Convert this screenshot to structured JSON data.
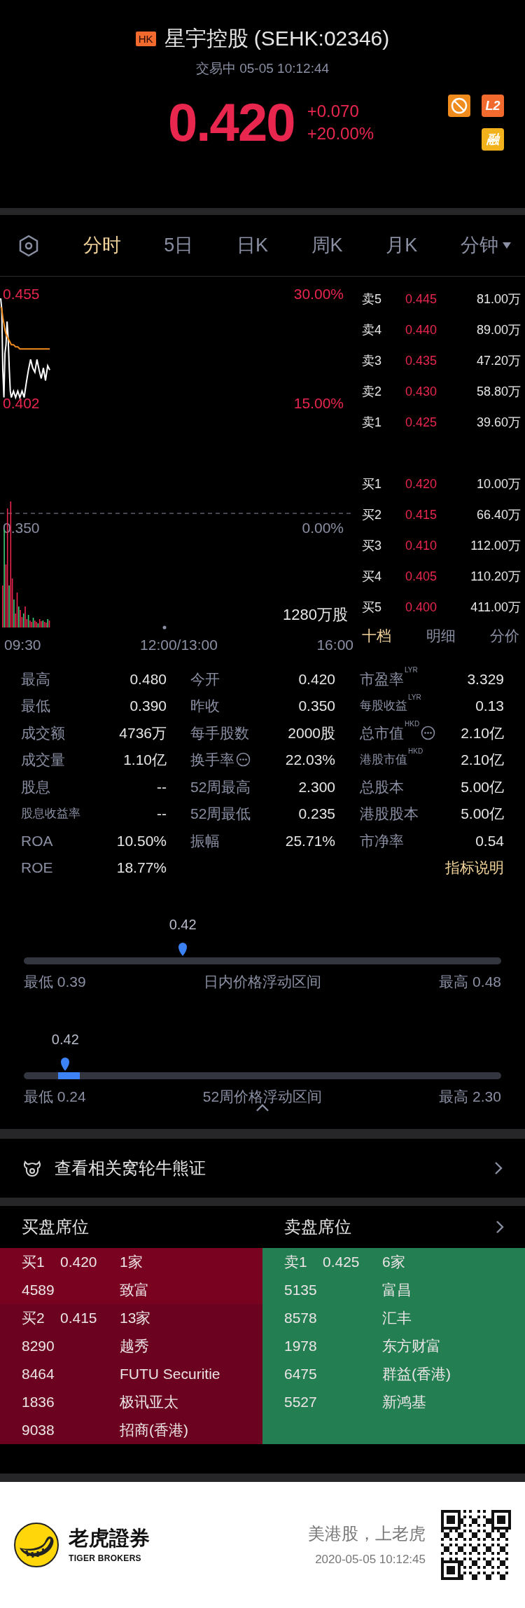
{
  "header": {
    "market_badge": "HK",
    "title": "星宇控股 (SEHK:02346)",
    "status": "交易中 05-05 10:12:44",
    "price": "0.420",
    "change": "+0.070",
    "change_pct": "+20.00%",
    "badges": [
      {
        "kind": "ban"
      },
      {
        "kind": "text",
        "text": "L2",
        "color": "#f26a2e"
      },
      {
        "kind": "text",
        "text": "融",
        "color": "#f2b21c"
      }
    ]
  },
  "chart_tabs": [
    {
      "label": "分时",
      "selected": true,
      "dropdown": false
    },
    {
      "label": "5日",
      "selected": false,
      "dropdown": false
    },
    {
      "label": "日K",
      "selected": false,
      "dropdown": false
    },
    {
      "label": "周K",
      "selected": false,
      "dropdown": false
    },
    {
      "label": "月K",
      "selected": false,
      "dropdown": false
    },
    {
      "label": "分钟",
      "selected": false,
      "dropdown": true
    }
  ],
  "intraday": {
    "price_labels": [
      "0.455",
      "0.402",
      "0.350"
    ],
    "time_labels": [
      "09:30",
      "12:00/13:00",
      "16:00"
    ],
    "pct_labels": [
      {
        "text": "30.00%",
        "color": "#e8264e"
      },
      {
        "text": "15.00%",
        "color": "#e8264e"
      },
      {
        "text": "0.00%",
        "color": "#8a8fa3"
      }
    ],
    "volume_label": "1280万股"
  },
  "order_book": {
    "asks": [
      {
        "label": "卖5",
        "price": "0.445",
        "volume": "81.00万"
      },
      {
        "label": "卖4",
        "price": "0.440",
        "volume": "89.00万"
      },
      {
        "label": "卖3",
        "price": "0.435",
        "volume": "47.20万"
      },
      {
        "label": "卖2",
        "price": "0.430",
        "volume": "58.80万"
      },
      {
        "label": "卖1",
        "price": "0.425",
        "volume": "39.60万"
      }
    ],
    "bids": [
      {
        "label": "买1",
        "price": "0.420",
        "volume": "10.00万"
      },
      {
        "label": "买2",
        "price": "0.415",
        "volume": "66.40万"
      },
      {
        "label": "买3",
        "price": "0.410",
        "volume": "112.00万"
      },
      {
        "label": "买4",
        "price": "0.405",
        "volume": "110.20万"
      },
      {
        "label": "买5",
        "price": "0.400",
        "volume": "411.00万"
      }
    ],
    "tabs": [
      {
        "label": "十档",
        "selected": true
      },
      {
        "label": "明细",
        "selected": false
      },
      {
        "label": "分价",
        "selected": false
      }
    ]
  },
  "stats": [
    [
      {
        "label": "最高",
        "value": "0.480",
        "small": false,
        "info": false
      },
      {
        "label": "最低",
        "value": "0.390",
        "small": false,
        "info": false
      },
      {
        "label": "成交额",
        "value": "4736万",
        "small": false,
        "info": false
      },
      {
        "label": "成交量",
        "value": "1.10亿",
        "small": false,
        "info": false
      },
      {
        "label": "股息",
        "value": "--",
        "small": false,
        "info": false
      },
      {
        "label": "股息收益率",
        "value": "--",
        "small": true,
        "info": false
      },
      {
        "label": "ROA",
        "value": "10.50%",
        "small": false,
        "info": false
      },
      {
        "label": "ROE",
        "value": "18.77%",
        "small": false,
        "info": false
      }
    ],
    [
      {
        "label": "今开",
        "value": "0.420",
        "small": false,
        "info": false
      },
      {
        "label": "昨收",
        "value": "0.350",
        "small": false,
        "info": false
      },
      {
        "label": "每手股数",
        "value": "2000股",
        "small": false,
        "info": false
      },
      {
        "label": "换手率",
        "value": "22.03%",
        "small": false,
        "info": true
      },
      {
        "label": "52周最高",
        "value": "2.300",
        "small": false,
        "info": false
      },
      {
        "label": "52周最低",
        "value": "0.235",
        "small": false,
        "info": false
      },
      {
        "label": "振幅",
        "value": "25.71%",
        "small": false,
        "info": false
      }
    ],
    [
      {
        "label": "市盈率",
        "sup": "LYR",
        "value": "3.329",
        "small": false,
        "info": false
      },
      {
        "label": "每股收益",
        "sup": "LYR",
        "value": "0.13",
        "small": true,
        "info": false
      },
      {
        "label": "总市值",
        "sup": "HKD",
        "value": "2.10亿",
        "small": false,
        "info": true
      },
      {
        "label": "港股市值",
        "sup": "HKD",
        "value": "2.10亿",
        "small": true,
        "info": false
      },
      {
        "label": "总股本",
        "value": "5.00亿",
        "small": false,
        "info": false
      },
      {
        "label": "港股股本",
        "value": "5.00亿",
        "small": false,
        "info": false
      },
      {
        "label": "市净率",
        "value": "0.54",
        "small": false,
        "info": false
      }
    ]
  ],
  "stats_link": "指标说明",
  "ranges": [
    {
      "current": "0.42",
      "level": 0.333,
      "band": false,
      "low": "最低 0.39",
      "title": "日内价格浮动区间",
      "high": "最高 0.48"
    },
    {
      "current": "0.42",
      "level": 0.087,
      "band": true,
      "low": "最低 0.24",
      "title": "52周价格浮动区间",
      "high": "最高 2.30"
    }
  ],
  "warrants_link": "查看相关窝轮牛熊证",
  "broker_queue": {
    "buy_title": "买盘席位",
    "sell_title": "卖盘席位",
    "buy": [
      {
        "rank": "买1",
        "price": "0.420",
        "count": "1家",
        "color": "#7a0221",
        "brokers": [
          {
            "code": "4589",
            "name": "致富"
          }
        ]
      },
      {
        "rank": "买2",
        "price": "0.415",
        "count": "13家",
        "color": "#6b0220",
        "brokers": [
          {
            "code": "8290",
            "name": "越秀"
          },
          {
            "code": "8464",
            "name": "FUTU Securitie"
          },
          {
            "code": "1836",
            "name": "极讯亚太"
          },
          {
            "code": "9038",
            "name": "招商(香港)"
          }
        ]
      }
    ],
    "sell": [
      {
        "rank": "卖1",
        "price": "0.425",
        "count": "6家",
        "color": "#237f52",
        "brokers": [
          {
            "code": "5135",
            "name": "富昌"
          },
          {
            "code": "8578",
            "name": "汇丰"
          },
          {
            "code": "1978",
            "name": "东方财富"
          },
          {
            "code": "6475",
            "name": "群益(香港)"
          },
          {
            "code": "5527",
            "name": "新鸿基"
          }
        ]
      }
    ]
  },
  "footer": {
    "brand": "老虎證券",
    "brand_en": "TIGER BROKERS",
    "slogan": "美港股，上老虎",
    "timestamp": "2020-05-05 10:12:45"
  }
}
